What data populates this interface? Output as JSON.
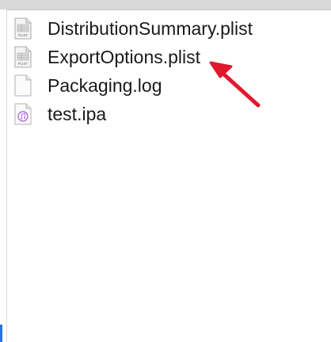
{
  "files": [
    {
      "name": "DistributionSummary.plist",
      "icon": "plist-file-icon",
      "icon_label": "PLIST"
    },
    {
      "name": "ExportOptions.plist",
      "icon": "plist-file-icon",
      "icon_label": "PLIST"
    },
    {
      "name": "Packaging.log",
      "icon": "blank-document-icon"
    },
    {
      "name": "test.ipa",
      "icon": "ipa-music-file-icon"
    }
  ],
  "colors": {
    "arrow": "#e0192f",
    "selection_edge": "#2b73d8"
  }
}
